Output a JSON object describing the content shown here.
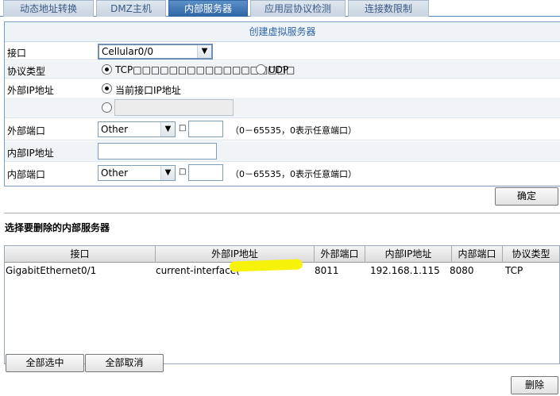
{
  "tabs": [
    {
      "label": "动态地址转换"
    },
    {
      "label": "DMZ主机"
    },
    {
      "label": "内部服务器"
    },
    {
      "label": "应用层协议检测"
    },
    {
      "label": "连接数限制"
    }
  ],
  "form": {
    "title": "创建虚拟服务器",
    "interface": {
      "label": "接口",
      "value": "Cellular0/0"
    },
    "protocol": {
      "label": "协议类型",
      "tcp": "TCP□□□□□□□□□□□□□□□□□□",
      "udp": "UDP",
      "selected": "tcp"
    },
    "external_ip": {
      "label": "外部IP地址",
      "current_option": "当前接口IP地址",
      "custom_value": "",
      "selected": "current"
    },
    "external_port": {
      "label": "外部端口",
      "select_value": "Other",
      "sep": "□",
      "value": "",
      "hint": "（0－65535，0表示任意端口）"
    },
    "internal_ip": {
      "label": "内部IP地址",
      "value": ""
    },
    "internal_port": {
      "label": "内部端口",
      "select_value": "Other",
      "sep": "□",
      "value": "",
      "hint": "（0－65535，0表示任意端口）"
    },
    "confirm_label": "确定"
  },
  "delete_section": {
    "title": "选择要删除的内部服务器",
    "columns": [
      "接口",
      "外部IP地址",
      "外部端口",
      "内部IP地址",
      "内部端口",
      "协议类型"
    ],
    "rows": [
      {
        "interface": "GigabitEthernet0/1",
        "external_ip": "current-interface(",
        "external_port": "8011",
        "internal_ip": "192.168.1.115",
        "internal_port": "8080",
        "protocol": "TCP"
      }
    ],
    "select_all_label": "全部选中",
    "deselect_all_label": "全部取消",
    "delete_label": "删除"
  },
  "colors": {
    "accent": "#2f64a6",
    "redaction": "#f7f20a"
  }
}
